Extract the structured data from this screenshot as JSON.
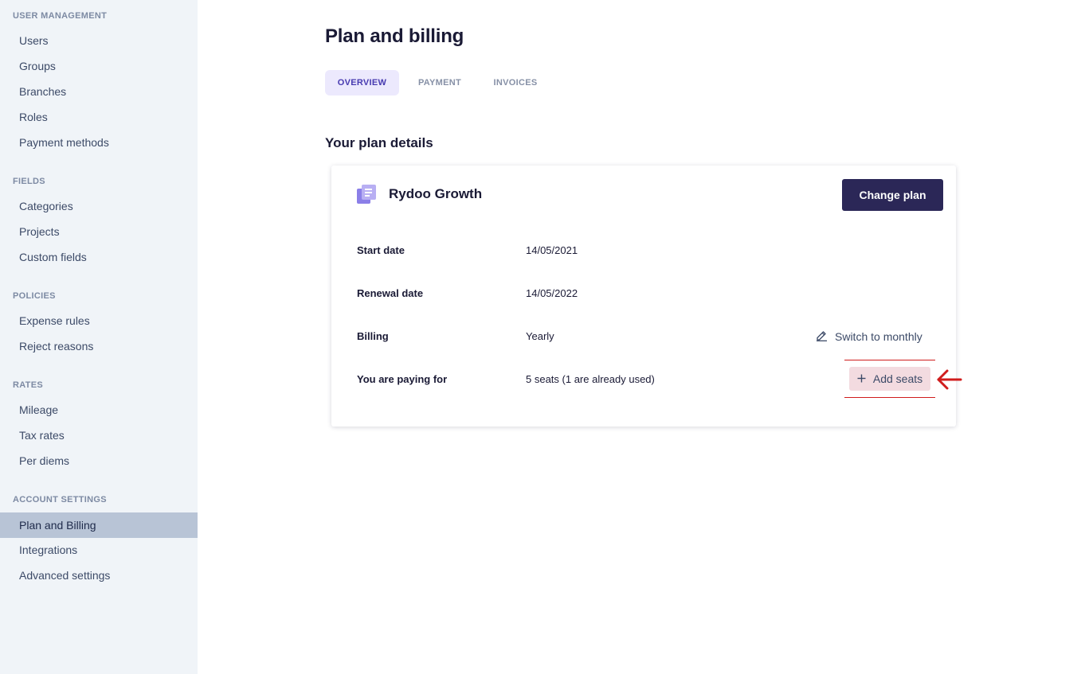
{
  "sidebar": {
    "sections": [
      {
        "title": "USER MANAGEMENT",
        "items": [
          "Users",
          "Groups",
          "Branches",
          "Roles",
          "Payment methods"
        ]
      },
      {
        "title": "FIELDS",
        "items": [
          "Categories",
          "Projects",
          "Custom fields"
        ]
      },
      {
        "title": "POLICIES",
        "items": [
          "Expense rules",
          "Reject reasons"
        ]
      },
      {
        "title": "RATES",
        "items": [
          "Mileage",
          "Tax rates",
          "Per diems"
        ]
      },
      {
        "title": "ACCOUNT SETTINGS",
        "items": [
          "Plan and Billing",
          "Integrations",
          "Advanced settings"
        ]
      }
    ],
    "active_item": "Plan and Billing"
  },
  "page": {
    "title": "Plan and billing",
    "tabs": [
      "OVERVIEW",
      "PAYMENT",
      "INVOICES"
    ],
    "active_tab": "OVERVIEW",
    "section_heading": "Your plan details"
  },
  "plan": {
    "icon": "document-stack-icon",
    "name": "Rydoo Growth",
    "change_button": "Change plan",
    "rows": [
      {
        "label": "Start date",
        "value": "14/05/2021"
      },
      {
        "label": "Renewal date",
        "value": "14/05/2022"
      },
      {
        "label": "Billing",
        "value": "Yearly"
      },
      {
        "label": "You are paying for",
        "value": "5 seats (1 are already used)"
      }
    ],
    "switch_link": {
      "icon": "pencil-icon",
      "label": "Switch to monthly"
    },
    "add_seats_button": {
      "icon": "plus-icon",
      "label": "Add seats"
    }
  },
  "annotation": {
    "icon": "arrow-left-icon",
    "color": "#d01c1c"
  },
  "colors": {
    "sidebar_bg": "#f0f4f8",
    "sidebar_active": "#b8c4d6",
    "primary": "#2b2757",
    "tab_active_bg": "#ece9fd",
    "tab_active_text": "#473ab0",
    "icon_purple": "#8b7fe8"
  }
}
